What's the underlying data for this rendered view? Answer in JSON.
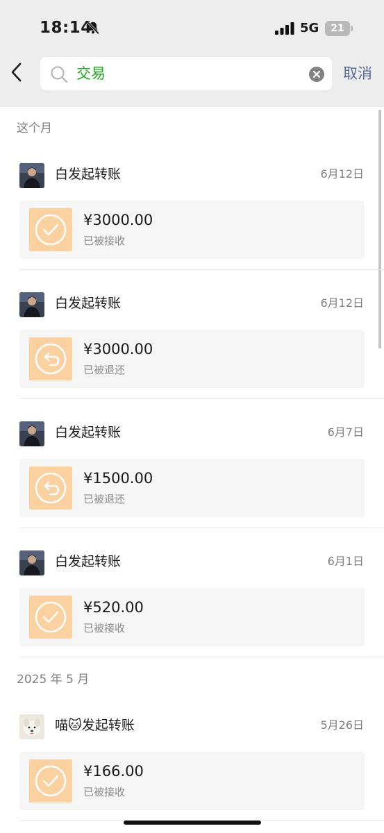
{
  "status_bar": {
    "time": "18:14",
    "network": "5G",
    "battery": "21"
  },
  "search": {
    "query": "交易",
    "cancel_label": "取消"
  },
  "sections": [
    {
      "title": "这个月"
    },
    {
      "title": "2025 年 5 月"
    }
  ],
  "transactions": [
    {
      "sender": "白发起转账",
      "date": "6月12日",
      "amount": "¥3000.00",
      "status": "已被接收",
      "icon": "check-circle-icon",
      "avatar": "avatar-photo-man"
    },
    {
      "sender": "白发起转账",
      "date": "6月12日",
      "amount": "¥3000.00",
      "status": "已被退还",
      "icon": "return-arrow-icon",
      "avatar": "avatar-photo-man"
    },
    {
      "sender": "白发起转账",
      "date": "6月7日",
      "amount": "¥1500.00",
      "status": "已被退还",
      "icon": "return-arrow-icon",
      "avatar": "avatar-photo-man"
    },
    {
      "sender": "白发起转账",
      "date": "6月1日",
      "amount": "¥520.00",
      "status": "已被接收",
      "icon": "check-circle-icon",
      "avatar": "avatar-photo-man"
    },
    {
      "sender": "喵🐱发起转账",
      "date": "5月26日",
      "amount": "¥166.00",
      "status": "已被接收",
      "icon": "check-circle-icon",
      "avatar": "avatar-photo-dog"
    }
  ],
  "colors": {
    "accent_green": "#1aad19",
    "link_blue": "#576b95",
    "transfer_orange": "#fcd1a0",
    "background_gray": "#ededed"
  }
}
